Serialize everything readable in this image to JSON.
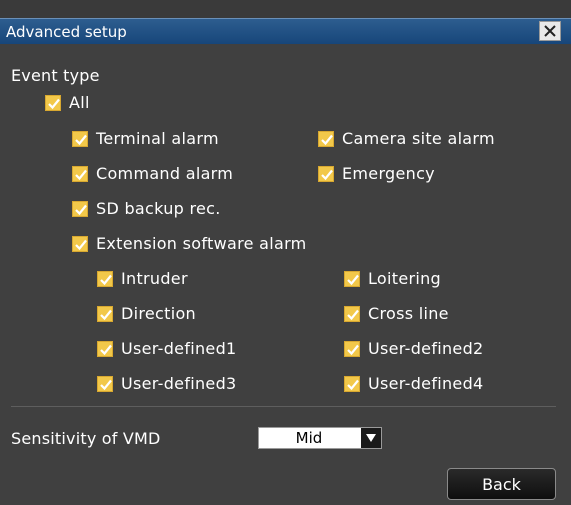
{
  "window": {
    "title": "Advanced setup",
    "close_icon": "close-icon"
  },
  "event_type": {
    "heading": "Event type",
    "all": {
      "label": "All",
      "checked": true
    },
    "items": [
      {
        "label": "Terminal alarm",
        "checked": true
      },
      {
        "label": "Camera site alarm",
        "checked": true
      },
      {
        "label": "Command alarm",
        "checked": true
      },
      {
        "label": "Emergency",
        "checked": true
      },
      {
        "label": "SD backup rec.",
        "checked": true
      },
      {
        "label": "Extension software alarm",
        "checked": true
      }
    ],
    "extension_items": [
      {
        "label": "Intruder",
        "checked": true
      },
      {
        "label": "Loitering",
        "checked": true
      },
      {
        "label": "Direction",
        "checked": true
      },
      {
        "label": "Cross line",
        "checked": true
      },
      {
        "label": "User-defined1",
        "checked": true
      },
      {
        "label": "User-defined2",
        "checked": true
      },
      {
        "label": "User-defined3",
        "checked": true
      },
      {
        "label": "User-defined4",
        "checked": true
      }
    ]
  },
  "sensitivity": {
    "label": "Sensitivity of VMD",
    "value": "Mid"
  },
  "footer": {
    "back_label": "Back"
  },
  "colors": {
    "titlebar": "#17467a",
    "checkbox": "#f2c84a",
    "panel": "#404040"
  }
}
